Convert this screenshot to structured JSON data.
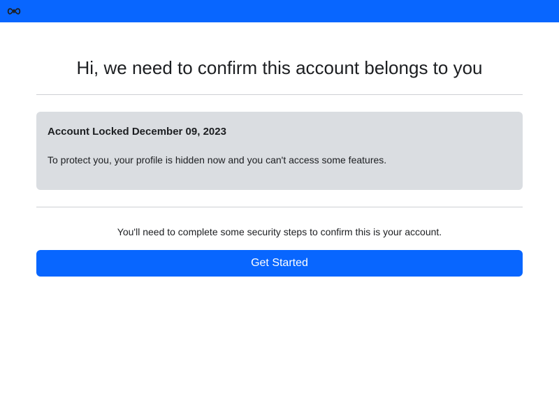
{
  "header": {
    "logo_icon": "meta-logo-icon",
    "background_color": "#0866ff"
  },
  "main": {
    "title": "Hi, we need to confirm this account belongs to you",
    "notice": {
      "title": "Account Locked December 09, 2023",
      "body": "To protect you, your profile is hidden now and you can't access some features.",
      "background_color": "#dadde1"
    },
    "instruction": "You'll need to complete some security steps to confirm this is your account.",
    "cta_label": "Get Started",
    "accent_color": "#0866ff"
  }
}
